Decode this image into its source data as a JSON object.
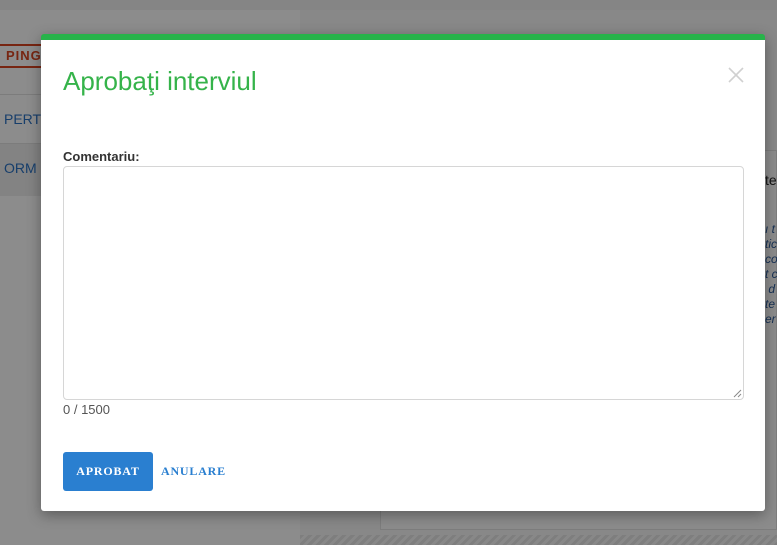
{
  "background": {
    "badge_text": "PING",
    "nav_item_1": "PERT",
    "nav_item_2": "ORM",
    "card_title": "te",
    "card_text": "ı t\ntic\nco\nt c\n d\nte\ner"
  },
  "modal": {
    "title": "Aprobaţi interviul",
    "close_icon": "close-icon",
    "comment_label": "Comentariu:",
    "comment_value": "",
    "comment_placeholder": "",
    "char_count": "0 / 1500",
    "approve_label": "APROBAT",
    "cancel_label": "ANULARE"
  },
  "colors": {
    "accent_green": "#27b34a",
    "title_green": "#35b34a",
    "primary_blue": "#2a7fd0",
    "badge_red": "#d9441f"
  }
}
